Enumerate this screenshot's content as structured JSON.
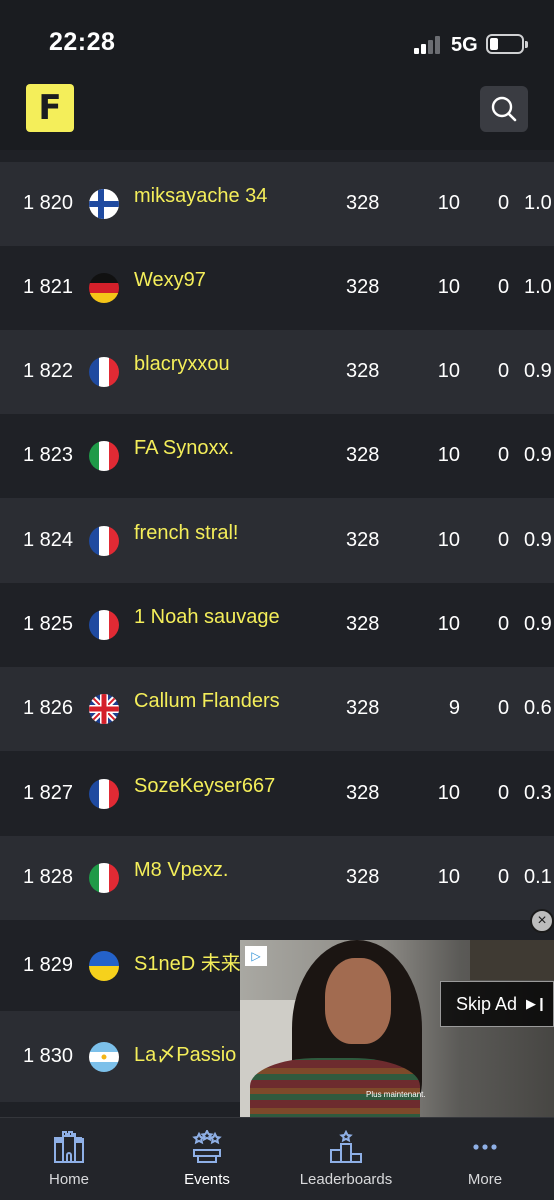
{
  "status_bar": {
    "time": "22:28",
    "network": "5G"
  },
  "header": {
    "logo_text": "F",
    "search_icon": "search-icon"
  },
  "rows": [
    {
      "rank": "1 820",
      "flag": "finland",
      "name": "miksayache 34",
      "points": "328",
      "wins": "10",
      "elims": "0",
      "ratio": "1.0"
    },
    {
      "rank": "1 821",
      "flag": "germany",
      "name": "Wexy97",
      "points": "328",
      "wins": "10",
      "elims": "0",
      "ratio": "1.0"
    },
    {
      "rank": "1 822",
      "flag": "france",
      "name": "blacryxxou",
      "points": "328",
      "wins": "10",
      "elims": "0",
      "ratio": "0.9"
    },
    {
      "rank": "1 823",
      "flag": "italy",
      "name": "FA Synoxx.",
      "points": "328",
      "wins": "10",
      "elims": "0",
      "ratio": "0.9"
    },
    {
      "rank": "1 824",
      "flag": "france",
      "name": "french stral!",
      "points": "328",
      "wins": "10",
      "elims": "0",
      "ratio": "0.9"
    },
    {
      "rank": "1 825",
      "flag": "france",
      "name": "1 Noah sauvage",
      "points": "328",
      "wins": "10",
      "elims": "0",
      "ratio": "0.9"
    },
    {
      "rank": "1 826",
      "flag": "uk",
      "name": "Callum Flanders",
      "points": "328",
      "wins": "9",
      "elims": "0",
      "ratio": "0.6"
    },
    {
      "rank": "1 827",
      "flag": "france",
      "name": "SozeKeyser667",
      "points": "328",
      "wins": "10",
      "elims": "0",
      "ratio": "0.3"
    },
    {
      "rank": "1 828",
      "flag": "italy",
      "name": "M8 Vpexz.",
      "points": "328",
      "wins": "10",
      "elims": "0",
      "ratio": "0.1"
    },
    {
      "rank": "1 829",
      "flag": "ukraine",
      "name": "S1neD 未来",
      "points": "",
      "wins": "",
      "elims": "",
      "ratio": ""
    },
    {
      "rank": "1 830",
      "flag": "argentina",
      "name": "La〆Passio",
      "points": "",
      "wins": "",
      "elims": "",
      "ratio": ""
    }
  ],
  "ad": {
    "caption": "Plus maintenant.",
    "skip_label": "Skip Ad",
    "info_icon": "ad-choices-icon",
    "close_icon": "close-icon"
  },
  "tabs": [
    {
      "label": "Home",
      "icon": "castle-icon",
      "active": false
    },
    {
      "label": "Events",
      "icon": "podium-stars-icon",
      "active": true
    },
    {
      "label": "Leaderboards",
      "icon": "leaderboard-podium-icon",
      "active": false
    },
    {
      "label": "More",
      "icon": "more-dots-icon",
      "active": false
    }
  ],
  "colors": {
    "accent": "#f4ee5a",
    "row_dark": "#1f2126",
    "row_light": "#2b2d33",
    "header_bg": "#1a1c20"
  }
}
